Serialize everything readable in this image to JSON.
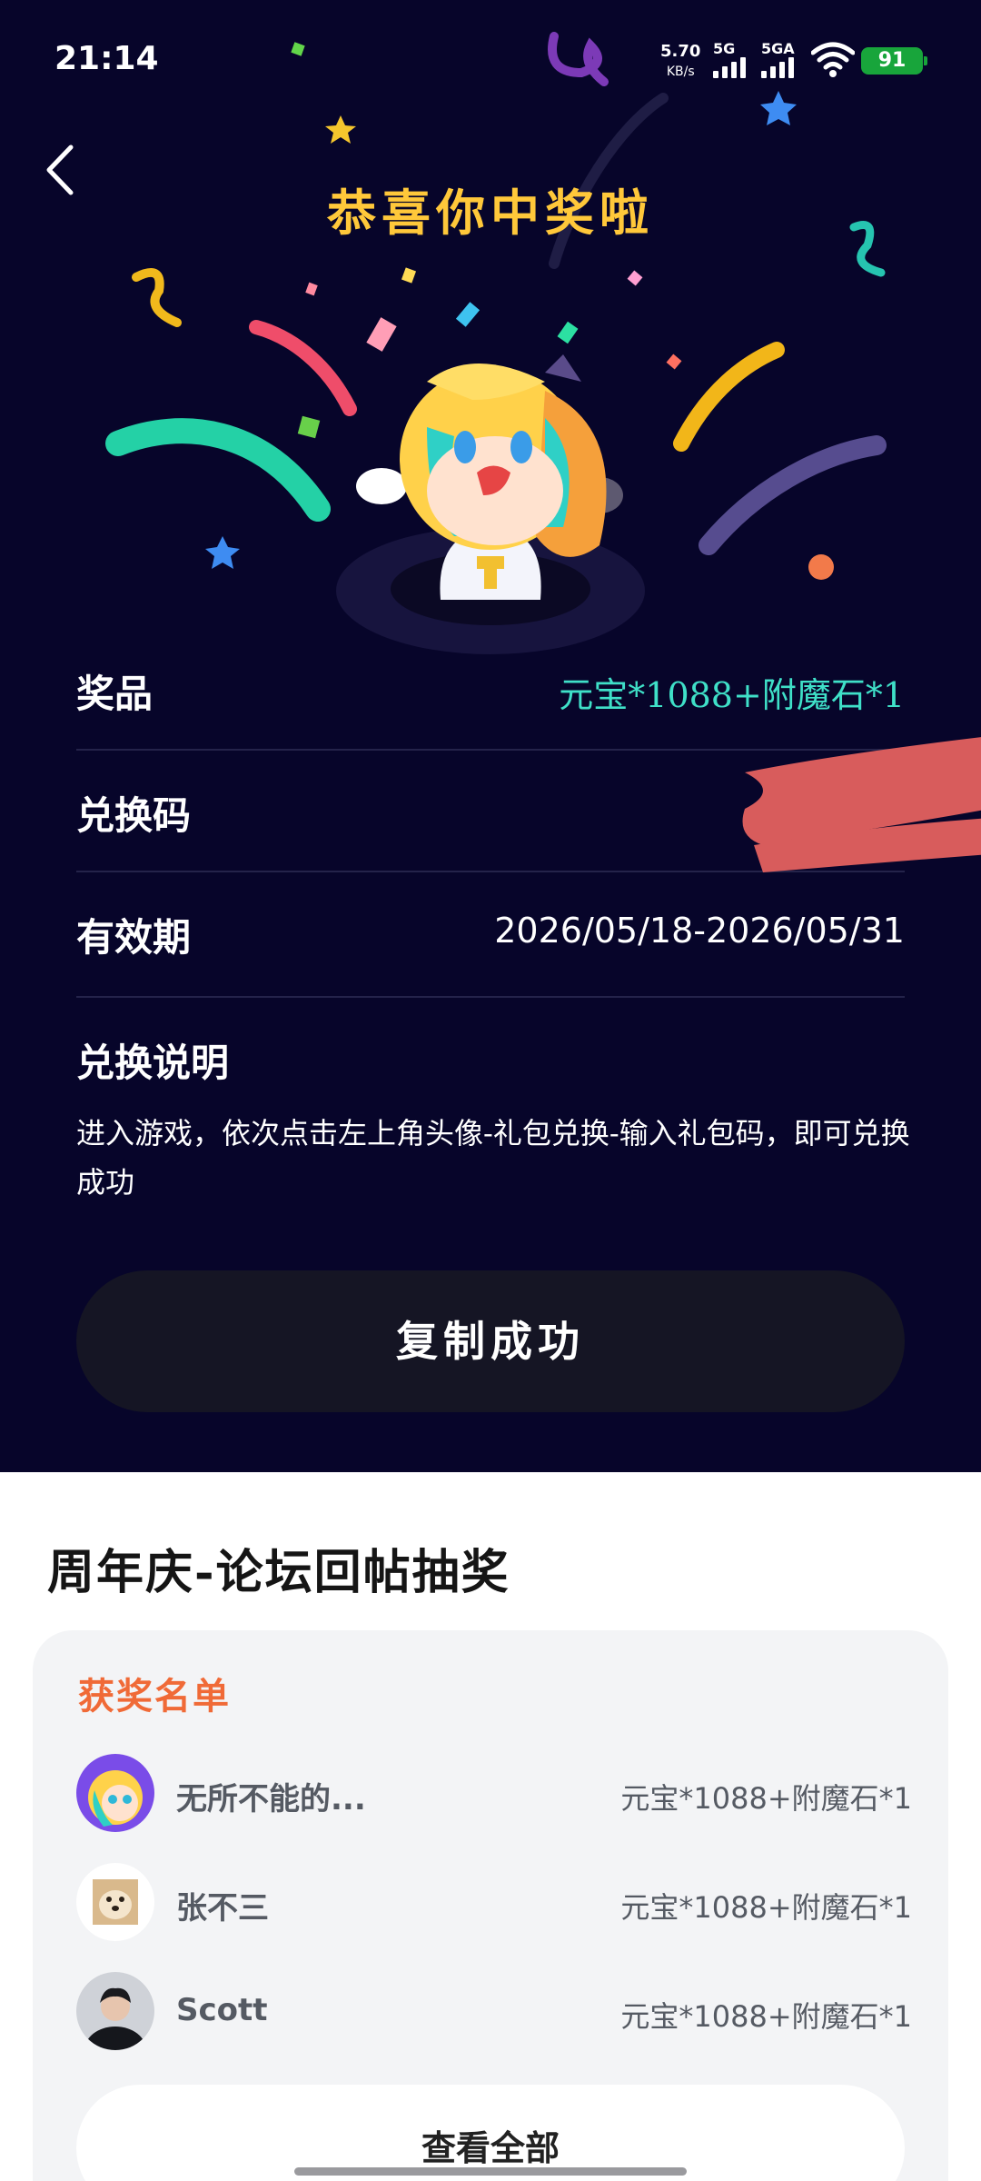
{
  "status_bar": {
    "time": "21:14",
    "net_speed": "5.70",
    "net_unit": "KB/s",
    "sim1": "5G",
    "sim2": "5GA",
    "battery": "91"
  },
  "header": {
    "title": "恭喜你中奖啦"
  },
  "prize_info": {
    "prize_label": "奖品",
    "prize_value": "元宝*1088+附魔石*1",
    "code_label": "兑换码",
    "validity_label": "有效期",
    "validity_value": "2026/05/18-2026/05/31",
    "instructions_label": "兑换说明",
    "instructions_text": "进入游戏，依次点击左上角头像-礼包兑换-输入礼包码，即可兑换成功"
  },
  "copy_button": "复制成功",
  "section": {
    "title": "周年庆-论坛回帖抽奖",
    "winners_title": "获奖名单",
    "winners": [
      {
        "name": "无所不能的...",
        "prize": "元宝*1088+附魔石*1"
      },
      {
        "name": "张不三",
        "prize": "元宝*1088+附魔石*1"
      },
      {
        "name": "Scott",
        "prize": "元宝*1088+附魔石*1"
      }
    ],
    "view_all": "查看全部"
  },
  "colors": {
    "background_dark": "#07052a",
    "title_gold": "#ffc83a",
    "prize_teal": "#3fe0c8",
    "winners_orange": "#f06a37",
    "battery_green": "#18a53b"
  },
  "icons": [
    "back-arrow-icon",
    "wifi-icon",
    "signal-icon",
    "battery-icon"
  ]
}
